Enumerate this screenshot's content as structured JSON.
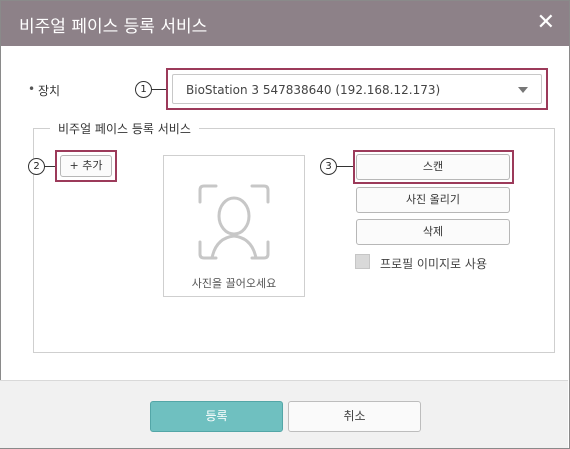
{
  "dialog": {
    "title": "비주얼 페이스 등록 서비스",
    "close_icon": "close-icon"
  },
  "device": {
    "label": "장치",
    "selected": "BioStation 3 547838640 (192.168.12.173)"
  },
  "group": {
    "legend": "비주얼 페이스 등록 서비스"
  },
  "buttons": {
    "add": "+ 추가",
    "scan": "스캔",
    "upload": "사진 올리기",
    "delete": "삭제"
  },
  "photo": {
    "hint": "사진을 끌어오세요",
    "icon": "face-scan-icon"
  },
  "profile": {
    "label": "프로필 이미지로 사용"
  },
  "footer": {
    "register": "등록",
    "cancel": "취소"
  },
  "callouts": [
    "1",
    "2",
    "3"
  ],
  "colors": {
    "titlebar": "#8d8188",
    "highlight": "#9c3a5a",
    "primary": "#6fc0c0"
  }
}
